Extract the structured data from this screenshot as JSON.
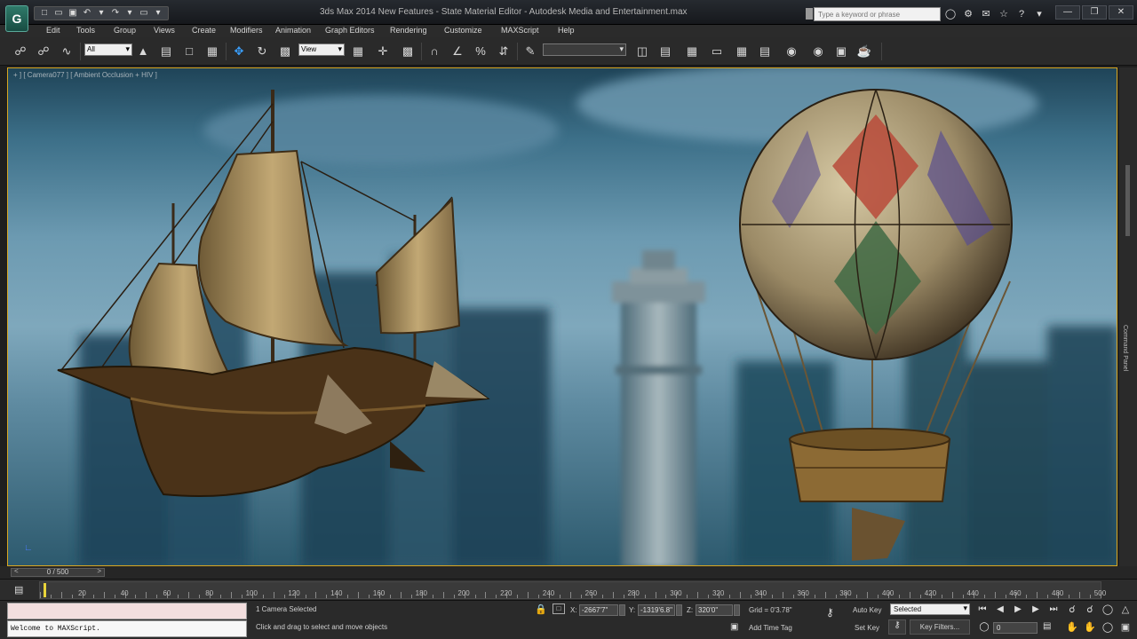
{
  "window": {
    "title": "3ds Max 2014 New Features - State Material Editor - Autodesk Media and Entertainment.max",
    "search_placeholder": "Type a keyword or phrase",
    "app_logo": "G"
  },
  "menu": [
    "Edit",
    "Tools",
    "Group",
    "Views",
    "Create",
    "Modifiers",
    "Animation",
    "Graph Editors",
    "Rendering",
    "Customize",
    "MAXScript",
    "Help"
  ],
  "toolbar": {
    "selection_filter": "All",
    "reference_coord": "View"
  },
  "viewport": {
    "label": "+ ] [ Camera077 ] [ Ambient Occlusion + HIV ]"
  },
  "command_panel": {
    "label": "Command Panel"
  },
  "time_slider": {
    "frame": "0 / 500"
  },
  "track_bar": {
    "ticks": [
      "20",
      "40",
      "60",
      "80",
      "100",
      "120",
      "140",
      "160",
      "180",
      "200",
      "220",
      "240",
      "260",
      "280",
      "300",
      "320",
      "340",
      "360",
      "380",
      "400",
      "420",
      "440",
      "460",
      "480",
      "500"
    ]
  },
  "status": {
    "maxscript_output": "Welcome to MAXScript.",
    "selection": "1 Camera Selected",
    "prompt": "Click and drag to select and move objects",
    "x_label": "X:",
    "x_value": "-2667'7\"",
    "y_label": "Y:",
    "y_value": "-1319'6.8\"",
    "z_label": "Z:",
    "z_value": "320'0\"",
    "grid": "Grid = 0'3.78\"",
    "add_time_tag": "Add Time Tag",
    "auto_key": "Auto Key",
    "set_key": "Set Key",
    "key_mode": "Selected",
    "key_filters": "Key Filters...",
    "current_frame": "0"
  }
}
